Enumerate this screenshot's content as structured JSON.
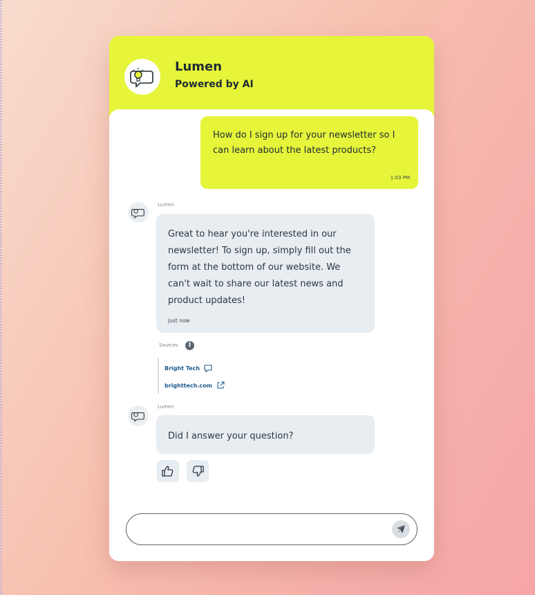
{
  "chat": {
    "bot_name": "Lumen",
    "powered_by": "Powered by AI",
    "messages": [
      {
        "text": "How do I sign up for your newsletter so I can learn about the latest products?",
        "time": "1:03 PM"
      },
      {
        "sender": "Lumen",
        "text": "Great to hear you're interested in our newsletter! To sign up, simply fill out the form at the bottom of our website. We can't wait to share our latest news and product updates!",
        "time": "Just now"
      },
      {
        "sender": "Lumen",
        "text": "Did I answer your question?"
      }
    ],
    "sources": {
      "label": "Sources",
      "items": [
        {
          "label": "Bright Tech",
          "icon": "chat-bubble-icon"
        },
        {
          "label": "brighttech.com",
          "icon": "external-link-icon"
        }
      ]
    },
    "feedback": {
      "up_icon": "thumbs-up-icon",
      "down_icon": "thumbs-down-icon"
    },
    "input": {
      "value": "",
      "placeholder": ""
    },
    "colors": {
      "accent": "#e6f53a",
      "bubble": "#e8edf1",
      "link": "#1d5a8c"
    }
  }
}
